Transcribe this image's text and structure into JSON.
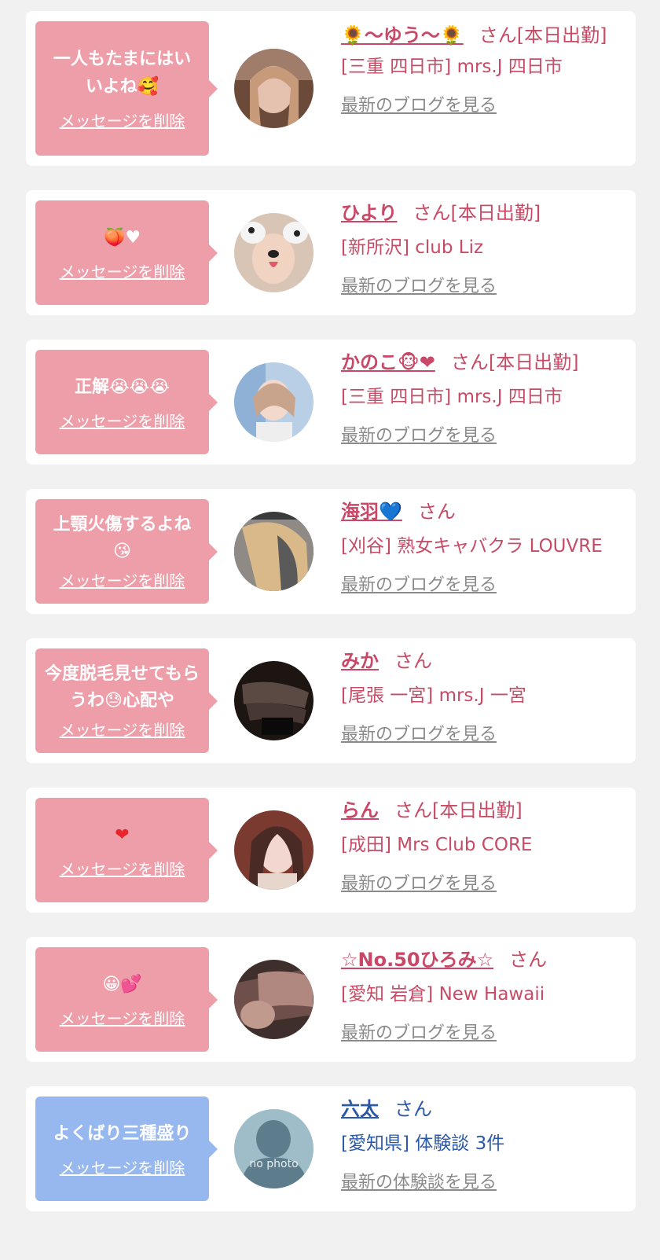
{
  "delete_label": "メッセージを削除",
  "cards": [
    {
      "message": "一人もたまにはいいよね🥰",
      "name": "🌻〜ゆう〜🌻",
      "status": "さん[本日出勤]",
      "shop": "[三重 四日市] mrs.J 四日市",
      "link": "最新のブログを見る",
      "avatar_icon": "profile-photo-icon",
      "bubble_color": "#ee9ea9"
    },
    {
      "message": "🍑♥",
      "name": "ひより",
      "status": "さん[本日出勤]",
      "shop": "[新所沢] club Liz",
      "link": "最新のブログを見る",
      "avatar_icon": "profile-photo-icon",
      "bubble_color": "#ee9ea9"
    },
    {
      "message": "正解😭😭😭",
      "name": "かのこ🐵❤",
      "status": "さん[本日出勤]",
      "shop": "[三重 四日市] mrs.J 四日市",
      "link": "最新のブログを見る",
      "avatar_icon": "profile-photo-icon",
      "bubble_color": "#ee9ea9"
    },
    {
      "message": "上顎火傷するよね😘",
      "name": "海羽💙",
      "status": "さん",
      "shop": "[刈谷] 熟女キャバクラ LOUVRE",
      "link": "最新のブログを見る",
      "avatar_icon": "profile-photo-icon",
      "bubble_color": "#ee9ea9"
    },
    {
      "message": "今度脱毛見せてもらうわ😓心配や",
      "name": "みか",
      "status": "さん",
      "shop": "[尾張 一宮] mrs.J 一宮",
      "link": "最新のブログを見る",
      "avatar_icon": "profile-photo-icon",
      "bubble_color": "#ee9ea9"
    },
    {
      "message": "❤",
      "name": "らん",
      "status": "さん[本日出勤]",
      "shop": "[成田] Mrs Club CORE",
      "link": "最新のブログを見る",
      "avatar_icon": "profile-photo-icon",
      "bubble_color": "#ee9ea9"
    },
    {
      "message": "😀💕",
      "name": "☆No.50ひろみ☆",
      "status": "さん",
      "shop": "[愛知 岩倉] New Hawaii",
      "link": "最新のブログを見る",
      "avatar_icon": "profile-photo-icon",
      "bubble_color": "#ee9ea9"
    },
    {
      "message": "よくばり三種盛り",
      "name": "六太",
      "status": "さん",
      "shop": "[愛知県] 体験談 3件",
      "link": "最新の体験談を見る",
      "avatar_icon": "no-photo-icon",
      "avatar_text": "no photo",
      "bubble_color": "#97b8ee"
    }
  ]
}
